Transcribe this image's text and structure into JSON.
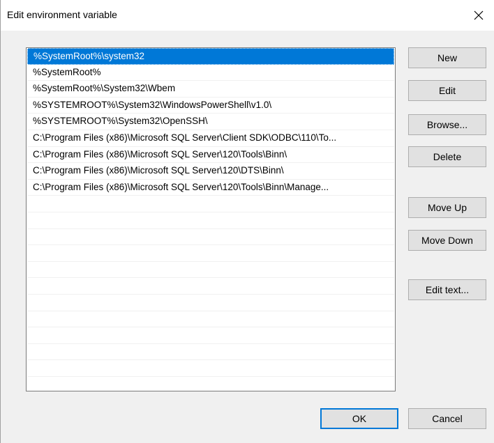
{
  "window": {
    "title": "Edit environment variable",
    "close_icon": "close-icon"
  },
  "list": {
    "selected_index": 0,
    "items": [
      "%SystemRoot%\\system32",
      "%SystemRoot%",
      "%SystemRoot%\\System32\\Wbem",
      "%SYSTEMROOT%\\System32\\WindowsPowerShell\\v1.0\\",
      "%SYSTEMROOT%\\System32\\OpenSSH\\",
      "C:\\Program Files (x86)\\Microsoft SQL Server\\Client SDK\\ODBC\\110\\To...",
      "C:\\Program Files (x86)\\Microsoft SQL Server\\120\\Tools\\Binn\\",
      "C:\\Program Files (x86)\\Microsoft SQL Server\\120\\DTS\\Binn\\",
      "C:\\Program Files (x86)\\Microsoft SQL Server\\120\\Tools\\Binn\\Manage..."
    ]
  },
  "buttons": {
    "new": "New",
    "edit": "Edit",
    "browse": "Browse...",
    "delete": "Delete",
    "move_up": "Move Up",
    "move_down": "Move Down",
    "edit_text": "Edit text...",
    "ok": "OK",
    "cancel": "Cancel"
  },
  "colors": {
    "selection": "#0078d7",
    "default_button_border": "#0078d7",
    "button_face": "#e1e1e1",
    "dialog_background": "#f0f0f0"
  }
}
